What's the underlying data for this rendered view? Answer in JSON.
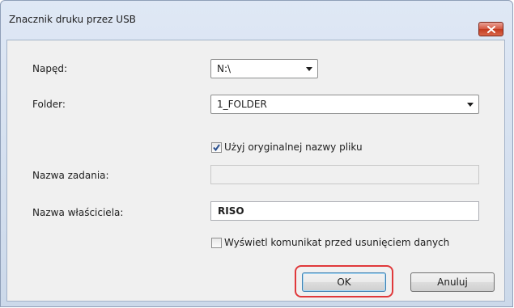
{
  "window": {
    "title": "Znacznik druku przez USB"
  },
  "form": {
    "drive": {
      "label": "Napęd:",
      "value": "N:\\"
    },
    "folder": {
      "label": "Folder:",
      "value": "1_FOLDER"
    },
    "use_original_name": {
      "label": "Użyj oryginalnej nazwy pliku",
      "checked": true
    },
    "job_name": {
      "label": "Nazwa zadania:",
      "value": "",
      "disabled": true
    },
    "owner_name": {
      "label": "Nazwa właściciela:",
      "value": "RISO"
    },
    "show_message": {
      "label": "Wyświetl komunikat przed usunięciem danych",
      "checked": false
    }
  },
  "buttons": {
    "ok": "OK",
    "cancel": "Anuluj"
  },
  "icons": {
    "close": "close-icon",
    "dropdown": "chevron-down-icon",
    "checkmark": "checkmark-icon"
  },
  "colors": {
    "highlight": "#e0393b",
    "close_button": "#c9482e"
  }
}
